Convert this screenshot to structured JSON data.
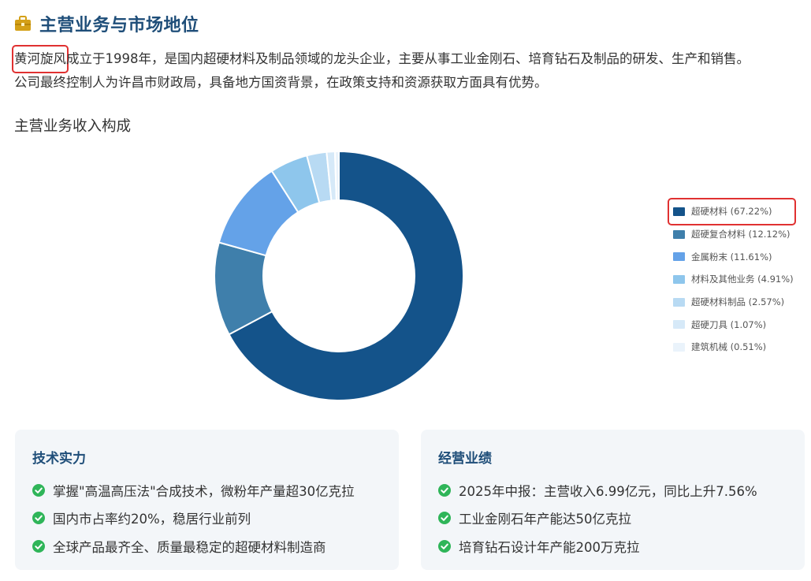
{
  "header": {
    "title": "主营业务与市场地位",
    "icon": "briefcase-icon",
    "icon_color": "#d4a017",
    "title_color": "#1f4e79"
  },
  "intro": {
    "company_name": "黄河旋风",
    "line1_rest": "成立于1998年，是国内超硬材料及制品领域的龙头企业，主要从事工业金刚石、培育钻石及制品的研发、生产和销售。",
    "line2": "公司最终控制人为许昌市财政局，具备地方国资背景，在政策支持和资源获取方面具有优势。"
  },
  "chart_section_title": "主营业务收入构成",
  "chart_data": {
    "type": "pie",
    "style": "donut",
    "categories": [
      "超硬材料",
      "超硬复合材料",
      "金属粉末",
      "材料及其他业务",
      "超硬材料制品",
      "超硬刀具",
      "建筑机械"
    ],
    "values": [
      67.22,
      12.12,
      11.61,
      4.91,
      2.57,
      1.07,
      0.51
    ],
    "legend_labels": [
      "超硬材料 (67.22%)",
      "超硬复合材料 (12.12%)",
      "金属粉末 (11.61%)",
      "材料及其他业务 (4.91%)",
      "超硬材料制品 (2.57%)",
      "超硬刀具 (1.07%)",
      "建筑机械 (0.51%)"
    ],
    "colors": [
      "#14538a",
      "#3f7fab",
      "#64a2e8",
      "#8ec6ec",
      "#b8daf3",
      "#d6e9f8",
      "#eaf3fb"
    ],
    "legend_position": "right"
  },
  "cards": [
    {
      "title": "技术实力",
      "items": [
        "掌握\"高温高压法\"合成技术，微粉年产量超30亿克拉",
        "国内市占率约20%，稳居行业前列",
        "全球产品最齐全、质量最稳定的超硬材料制造商"
      ]
    },
    {
      "title": "经营业绩",
      "items": [
        "2025年中报：主营收入6.99亿元，同比上升7.56%",
        "工业金刚石年产能达50亿克拉",
        "培育钻石设计年产能200万克拉"
      ]
    }
  ],
  "colors": {
    "accent": "#1f4e79",
    "check": "#2fb559",
    "highlight": "#e03131",
    "card_bg": "#f3f6f9"
  }
}
